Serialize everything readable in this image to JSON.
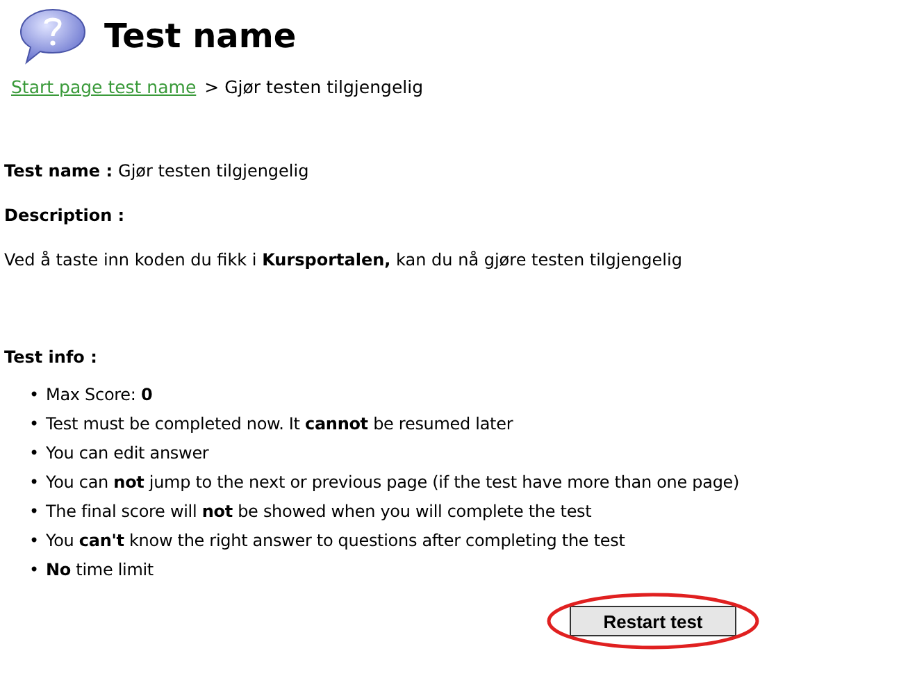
{
  "header": {
    "title": "Test name"
  },
  "breadcrumb": {
    "link": "Start page test name",
    "separator": ">",
    "current": "Gjør testen tilgjengelig"
  },
  "test_name": {
    "label": "Test name :",
    "value": "Gjør testen tilgjengelig"
  },
  "description": {
    "label": "Description :",
    "text": "Ved å taste inn koden du fikk i **Kursportalen,** kan du nå gjøre testen tilgjengelig"
  },
  "test_info": {
    "label": "Test info :",
    "items": [
      {
        "bullet": "•",
        "text": "Max Score: **0**"
      },
      {
        "bullet": "•",
        "text": "Test must be completed now. It **cannot** be resumed later"
      },
      {
        "bullet": "•",
        "text": "You can edit answer"
      },
      {
        "bullet": "•",
        "text": "You can **not** jump to the next or previous page (if the test have more than one page)"
      },
      {
        "bullet": "•",
        "text": "The final score will **not** be showed when you will complete the test"
      },
      {
        "bullet": "•",
        "text": "You **can't** know the right answer to questions after completing the test"
      },
      {
        "bullet": "•",
        "text": "**No** time limit"
      }
    ]
  },
  "restart_button": {
    "label": "Restart test",
    "highlighted": true
  }
}
